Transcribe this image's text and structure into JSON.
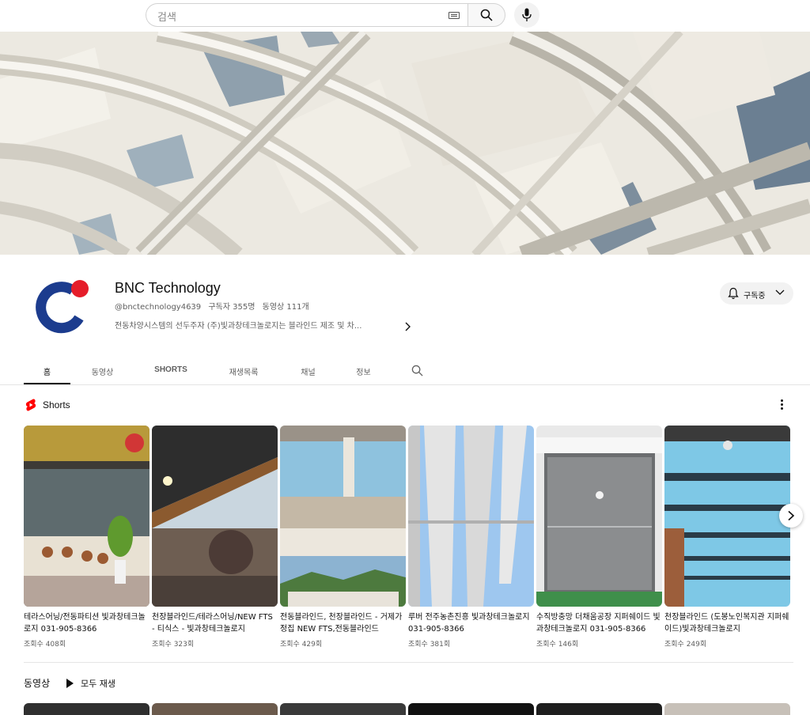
{
  "search": {
    "placeholder": "검색"
  },
  "channel": {
    "name": "BNC Technology",
    "handle": "@bnctechnology4639",
    "subscribers": "구독자 355명",
    "video_count": "동영상 111개",
    "description": "전동차양시스템의 선두주자 (주)빛과창테크놀로지는 블라인드 제조 및 차...",
    "subscribe_label": "구독중",
    "avatar_colors": {
      "ring": "#1c3c8e",
      "dot": "#e51d2a"
    }
  },
  "tabs": [
    {
      "label": "홈",
      "active": true
    },
    {
      "label": "동영상",
      "active": false
    },
    {
      "label": "SHORTS",
      "active": false
    },
    {
      "label": "재생목록",
      "active": false
    },
    {
      "label": "채널",
      "active": false
    },
    {
      "label": "정보",
      "active": false
    }
  ],
  "shorts_section": {
    "title": "Shorts",
    "items": [
      {
        "title": "테라스어닝/전동파티션 빛과창테크놀로지 031-905-8366",
        "views": "조회수 408회"
      },
      {
        "title": "천장블라인드/테라스어닝/NEW FTS - 티식스 - 빛과창테크놀로지",
        "views": "조회수 323회"
      },
      {
        "title": "전동블라인드, 천장블라인드 - 거제가정집 NEW FTS,전동블라인드",
        "views": "조회수 429회"
      },
      {
        "title": "루버 전주농촌진흥 빛과창테크놀로지 031-905-8366",
        "views": "조회수 381회"
      },
      {
        "title": "수직방충망 더채움공장 지퍼쉐이드 빛과창테크놀로지 031-905-8366",
        "views": "조회수 146회"
      },
      {
        "title": "천장블라인드 (도봉노인복지관 지퍼쉐이드)빛과창테크놀로지",
        "views": "조회수 249회"
      }
    ]
  },
  "videos_section": {
    "title": "동영상",
    "play_all_label": "모두 재생"
  },
  "colors": {
    "accent": "#ff0000",
    "text_primary": "#0f0f0f",
    "text_secondary": "#606060"
  }
}
